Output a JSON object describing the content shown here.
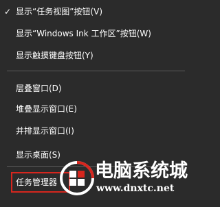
{
  "menu": {
    "items": [
      {
        "label": "显示“任务视图”按钮(V)",
        "checked": true
      },
      {
        "label": "显示“Windows Ink 工作区”按钮(W)",
        "checked": false
      },
      {
        "label": "显示触摸键盘按钮(Y)",
        "checked": false
      },
      {
        "label": "层叠窗口(D)",
        "checked": false
      },
      {
        "label": "堆叠显示窗口(E)",
        "checked": false
      },
      {
        "label": "并排显示窗口(I)",
        "checked": false
      },
      {
        "label": "显示桌面(S)",
        "checked": false
      },
      {
        "label": "任务管理器",
        "checked": false
      }
    ],
    "check_glyph": "✓"
  },
  "watermark": {
    "title": "电脑系统城",
    "url": "www.dnxtc.net"
  },
  "colors": {
    "background": "#2b2b2b",
    "text": "#ffffff",
    "divider": "#5a5a5a",
    "highlight": "#d7261e"
  }
}
